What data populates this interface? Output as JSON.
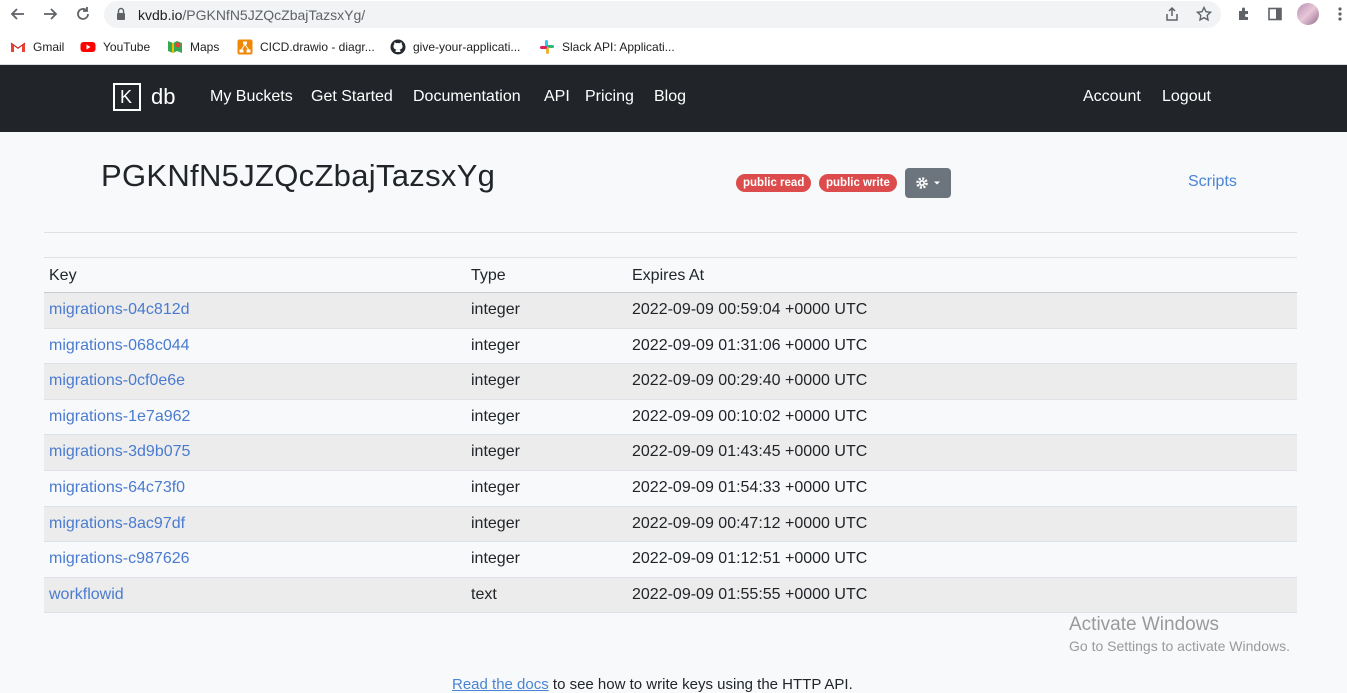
{
  "browser": {
    "url_host": "kvdb.io",
    "url_path": "/PGKNfN5JZQcZbajTazsxYg/",
    "bookmarks": [
      {
        "label": "Gmail",
        "icon": "gmail-icon"
      },
      {
        "label": "YouTube",
        "icon": "youtube-icon"
      },
      {
        "label": "Maps",
        "icon": "maps-icon"
      },
      {
        "label": "CICD.drawio - diagr...",
        "icon": "drawio-icon"
      },
      {
        "label": "give-your-applicati...",
        "icon": "github-icon"
      },
      {
        "label": "Slack API: Applicati...",
        "icon": "slack-icon"
      }
    ]
  },
  "navbar": {
    "logo_k": "K",
    "logo_db": "db",
    "links": [
      "My Buckets",
      "Get Started",
      "Documentation",
      "API",
      "Pricing",
      "Blog"
    ],
    "account": "Account",
    "logout": "Logout"
  },
  "bucket": {
    "title": "PGKNfN5JZQcZbajTazsxYg",
    "badges": [
      "public read",
      "public write"
    ],
    "gear_icon": "gear-icon",
    "scripts_label": "Scripts"
  },
  "table": {
    "headers": [
      "Key",
      "Type",
      "Expires At"
    ],
    "rows": [
      {
        "key": "migrations-04c812d",
        "type": "integer",
        "expires": "2022-09-09 00:59:04 +0000 UTC"
      },
      {
        "key": "migrations-068c044",
        "type": "integer",
        "expires": "2022-09-09 01:31:06 +0000 UTC"
      },
      {
        "key": "migrations-0cf0e6e",
        "type": "integer",
        "expires": "2022-09-09 00:29:40 +0000 UTC"
      },
      {
        "key": "migrations-1e7a962",
        "type": "integer",
        "expires": "2022-09-09 00:10:02 +0000 UTC"
      },
      {
        "key": "migrations-3d9b075",
        "type": "integer",
        "expires": "2022-09-09 01:43:45 +0000 UTC"
      },
      {
        "key": "migrations-64c73f0",
        "type": "integer",
        "expires": "2022-09-09 01:54:33 +0000 UTC"
      },
      {
        "key": "migrations-8ac97df",
        "type": "integer",
        "expires": "2022-09-09 00:47:12 +0000 UTC"
      },
      {
        "key": "migrations-c987626",
        "type": "integer",
        "expires": "2022-09-09 01:12:51 +0000 UTC"
      },
      {
        "key": "workflowid",
        "type": "text",
        "expires": "2022-09-09 01:55:55 +0000 UTC"
      }
    ]
  },
  "watermark": {
    "line1": "Activate Windows",
    "line2": "Go to Settings to activate Windows."
  },
  "footer": {
    "link_text": "Read the docs",
    "rest_text": " to see how to write keys using the HTTP API."
  }
}
